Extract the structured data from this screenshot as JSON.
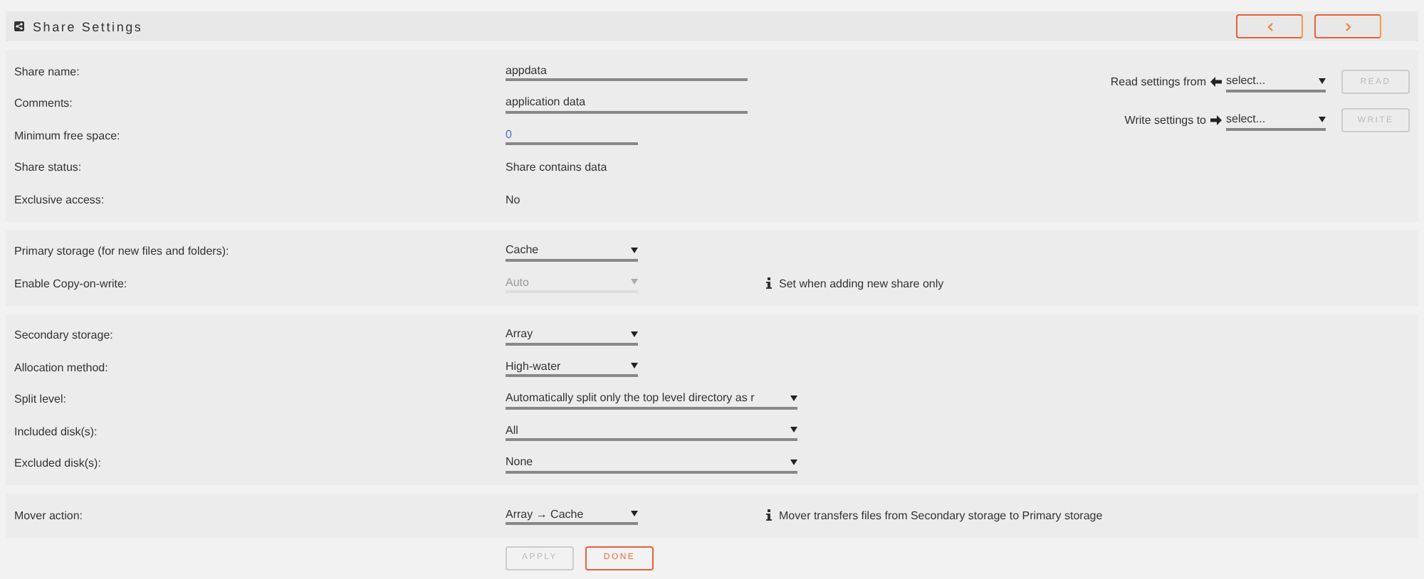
{
  "header": {
    "title": "Share Settings",
    "nav_buttons": [
      {
        "kind": "prev"
      },
      {
        "kind": "next"
      }
    ]
  },
  "sections": [
    {
      "rows": [
        {
          "label": "Share name:",
          "kind": "text-field",
          "value": "appdata",
          "disabled": false
        },
        {
          "label": "Comments:",
          "kind": "text-field",
          "value": "application data",
          "disabled": false
        },
        {
          "label": "Minimum free space:",
          "kind": "number-field",
          "value": "0",
          "disabled": false
        },
        {
          "label": "Share status:",
          "kind": "static",
          "value": "Share contains data",
          "disabled": false
        },
        {
          "label": "Exclusive access:",
          "kind": "static",
          "value": "No",
          "disabled": false
        }
      ],
      "side": [
        {
          "label": "Read settings from",
          "kind": "read",
          "placeholder": "select...",
          "button": "READ",
          "disabled": true
        },
        {
          "label": "Write settings to",
          "kind": "write",
          "placeholder": "select...",
          "button": "WRITE",
          "disabled": true
        }
      ]
    },
    {
      "rows": [
        {
          "label": "Primary storage (for new files and folders):",
          "kind": "select",
          "value": "Cache",
          "disabled": false
        },
        {
          "label": "Enable Copy-on-write:",
          "kind": "select",
          "value": "Auto",
          "disabled": true,
          "note": "Set when adding new share only"
        }
      ]
    },
    {
      "rows": [
        {
          "label": "Secondary storage:",
          "kind": "select",
          "value": "Array",
          "disabled": false
        },
        {
          "label": "Allocation method:",
          "kind": "select",
          "value": "High-water",
          "disabled": false
        },
        {
          "label": "Split level:",
          "kind": "wide-select",
          "value": "Automatically split only the top level directory as r",
          "disabled": false
        },
        {
          "label": "Included disk(s):",
          "kind": "wide-select",
          "value": "All",
          "disabled": false
        },
        {
          "label": "Excluded disk(s):",
          "kind": "wide-select",
          "value": "None",
          "disabled": false
        }
      ]
    },
    {
      "rows": [
        {
          "label": "Mover action:",
          "kind": "select",
          "value": "Array → Cache",
          "disabled": false,
          "note": "Mover transfers files from Secondary storage to Primary storage"
        }
      ]
    }
  ],
  "actions": [
    {
      "label": "APPLY",
      "disabled": true
    },
    {
      "label": "DONE",
      "disabled": false
    }
  ]
}
